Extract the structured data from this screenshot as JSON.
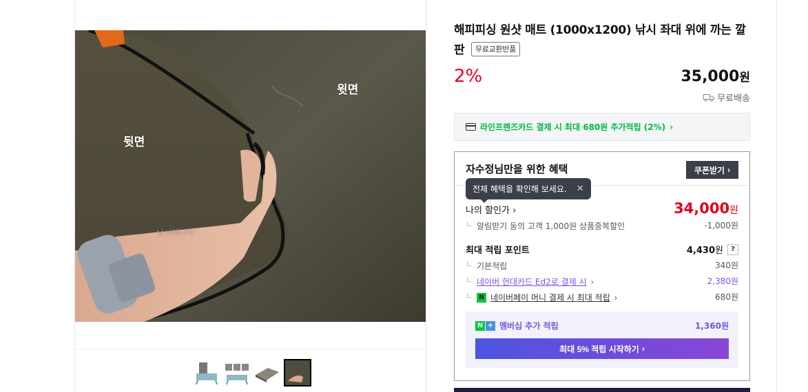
{
  "product": {
    "title": "해피피싱 원샷 매트 (1000x1200) 낚시 좌대 위에 까는 깔판",
    "return_badge": "무료교환반품",
    "discount": "2%",
    "price": "35,000",
    "price_unit": "원",
    "delivery": "무료배송"
  },
  "image": {
    "label_front": "윗면",
    "label_back": "뒷면",
    "watermark": "낚시매니아"
  },
  "card_promo": {
    "text": "라인프렌즈카드 결제 시 최대 680원 추가적립 (2%)",
    "chevron": "›"
  },
  "benefit": {
    "heading": "자수정님만을 위한 혜택",
    "coupon_button": "쿠폰받기",
    "tooltip": "전체 혜택을 확인해 보세요.",
    "tooltip_close": "✕",
    "my_price_label": "나의 할인가",
    "my_price": "34,000",
    "my_price_unit": "원",
    "discount_note": "알림받기 동의 고객 1,000원 상품중복할인",
    "discount_amount": "-1,000원",
    "points_label": "최대 적립 포인트",
    "points_total": "4,430",
    "points_unit": "원",
    "points_help": "?",
    "base_label": "기본적립",
    "base_value": "340원",
    "hyundai_label": "네이버 현대카드 Ed2로 결제 시",
    "hyundai_value": "2,380원",
    "npay_badge": "N",
    "npay_label": "네이버페이 머니 결제 시 최대 적립",
    "npay_value": "680원",
    "member_label": "멤버십 추가 적립",
    "member_value": "1,360원",
    "start_button": "최대 5% 적립 시작하기"
  },
  "colors": {
    "accent_red": "#e0001c",
    "accent_green": "#00b843",
    "accent_purple": "#7c52e0",
    "dark_button": "#3b3f4a"
  }
}
